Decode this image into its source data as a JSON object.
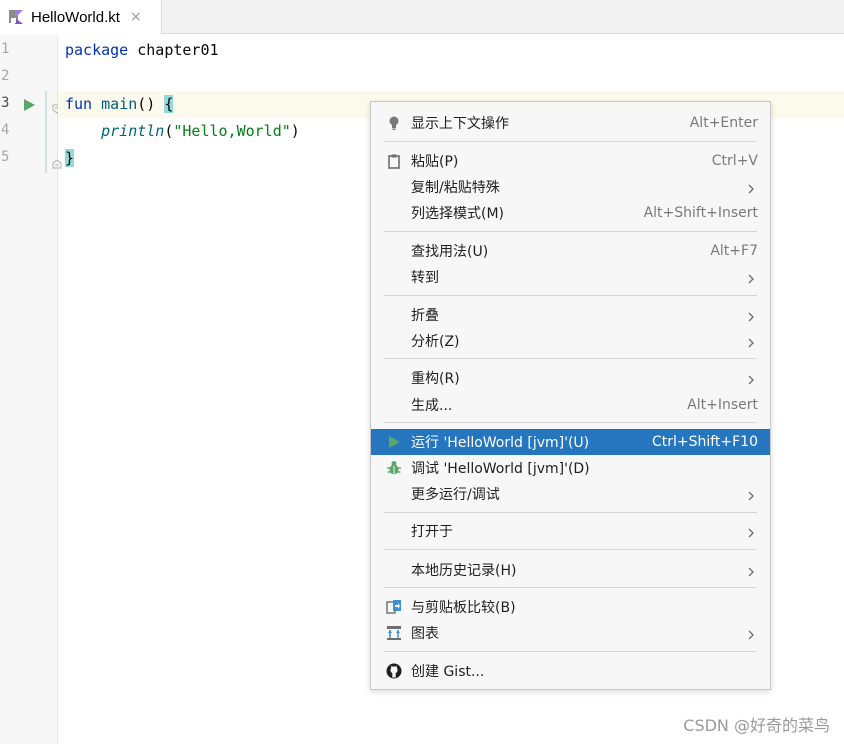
{
  "tab": {
    "title": "HelloWorld.kt",
    "close": "×"
  },
  "gutter": {
    "lines": [
      "1",
      "2",
      "3",
      "4",
      "5"
    ]
  },
  "code": {
    "line1": {
      "kw": "package",
      "rest": " chapter01"
    },
    "line3": {
      "kw": "fun",
      "fn": "main",
      "rest": "() ",
      "brace": "{"
    },
    "line4": {
      "indent": "    ",
      "fn": "println",
      "open": "(",
      "str": "\"Hello,World\"",
      "close": ")"
    },
    "line5": {
      "brace": "}"
    }
  },
  "menu": {
    "items": [
      {
        "label": "显示上下文操作",
        "shortcut": "Alt+Enter",
        "icon": "lightbulb-icon"
      },
      {
        "label": "粘贴(P)",
        "shortcut": "Ctrl+V",
        "icon": "clipboard-icon"
      },
      {
        "label": "复制/粘贴特殊",
        "shortcut": ""
      },
      {
        "label": "列选择模式(M)",
        "shortcut": "Alt+Shift+Insert"
      },
      {
        "label": "查找用法(U)",
        "shortcut": "Alt+F7"
      },
      {
        "label": "转到",
        "shortcut": ""
      },
      {
        "label": "折叠",
        "shortcut": ""
      },
      {
        "label": "分析(Z)",
        "shortcut": ""
      },
      {
        "label": "重构(R)",
        "shortcut": ""
      },
      {
        "label": "生成...",
        "shortcut": "Alt+Insert"
      },
      {
        "label": "运行 'HelloWorld [jvm]'(U)",
        "shortcut": "Ctrl+Shift+F10",
        "icon": "run-icon"
      },
      {
        "label": "调试 'HelloWorld [jvm]'(D)",
        "shortcut": "",
        "icon": "debug-bug-icon"
      },
      {
        "label": "更多运行/调试",
        "shortcut": ""
      },
      {
        "label": "打开于",
        "shortcut": ""
      },
      {
        "label": "本地历史记录(H)",
        "shortcut": ""
      },
      {
        "label": "与剪贴板比较(B)",
        "shortcut": "",
        "icon": "compare-icon"
      },
      {
        "label": "图表",
        "shortcut": "",
        "icon": "diagram-icon"
      },
      {
        "label": "创建 Gist...",
        "shortcut": "",
        "icon": "github-icon"
      }
    ]
  },
  "colors": {
    "menu_selected": "#2675bf",
    "keyword": "#0033b3",
    "string": "#067d17",
    "function": "#00627a",
    "run_green": "#59a869"
  },
  "watermark": "CSDN @好奇的菜鸟"
}
